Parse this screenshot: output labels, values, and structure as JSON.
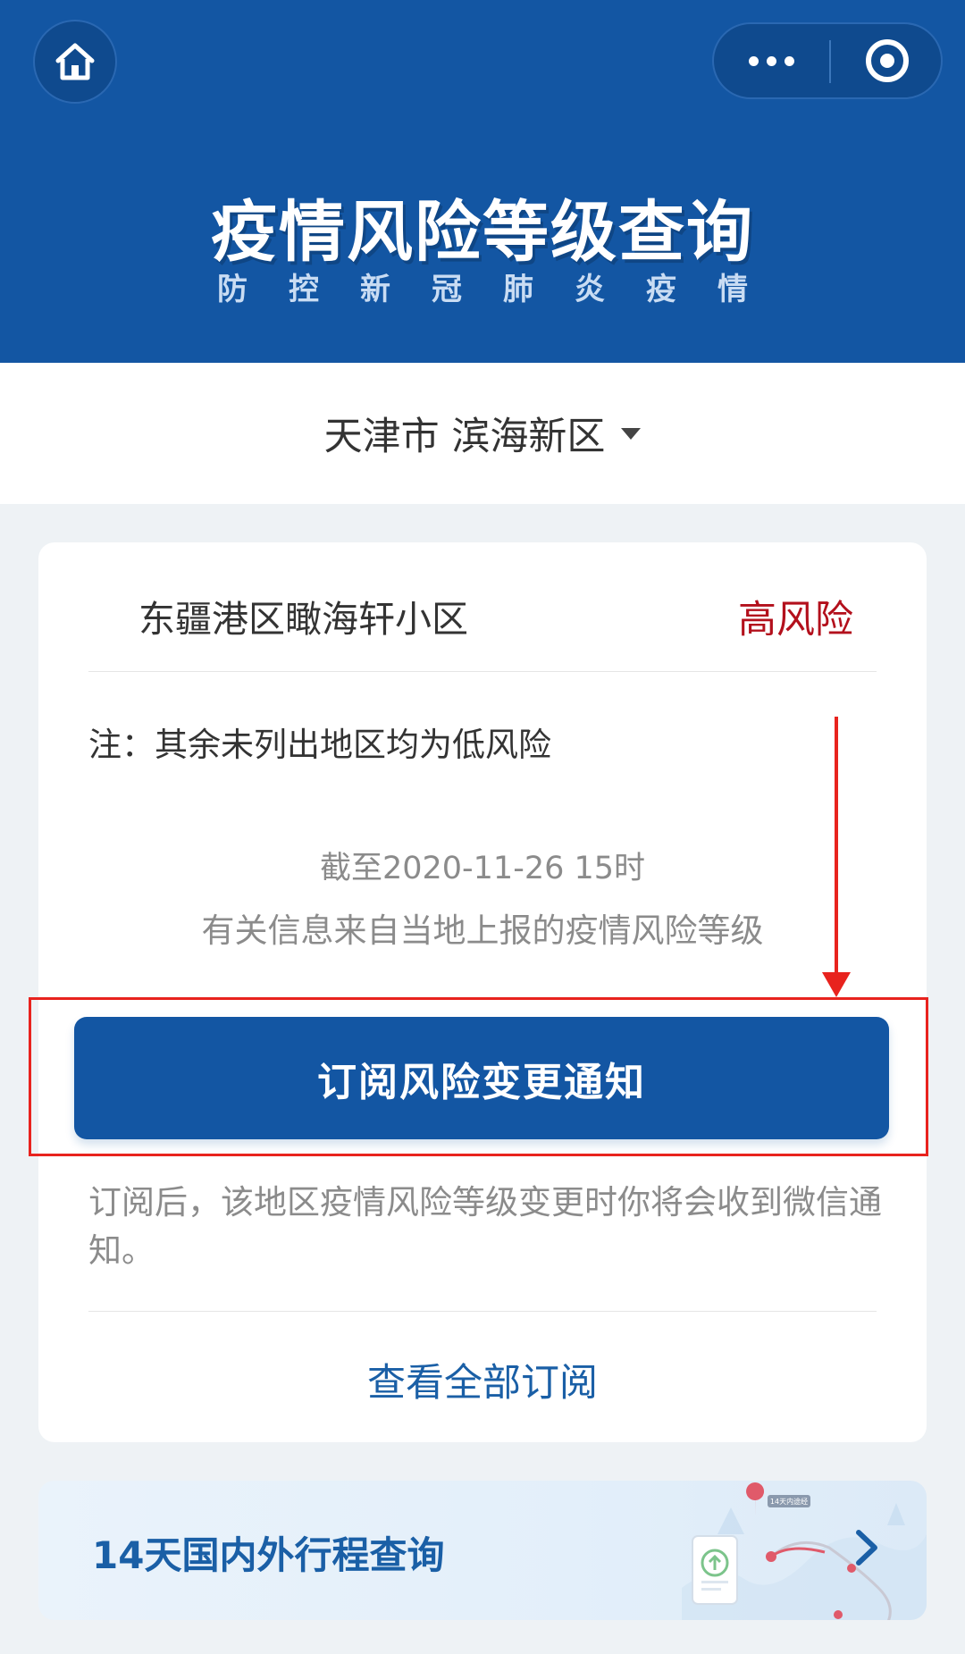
{
  "header": {
    "title": "疫情风险等级查询",
    "subtitle": "防控新冠肺炎疫情"
  },
  "region": {
    "label": "天津市 滨海新区"
  },
  "risk_card": {
    "place": "东疆港区瞰海轩小区",
    "level": "高风险",
    "level_color": "#b3101c",
    "note": "注：其余未列出地区均为低风险",
    "as_of": "截至2020-11-26 15时",
    "source": "有关信息来自当地上报的疫情风险等级",
    "subscribe_button": "订阅风险变更通知",
    "subscribe_hint": "订阅后，该地区疫情风险等级变更时你将会收到微信通知。",
    "view_all": "查看全部订阅"
  },
  "trip": {
    "label": "14天国内外行程查询",
    "art_badge": "14天内途经"
  },
  "colors": {
    "primary": "#1356a3",
    "highlight": "#e8231e"
  },
  "icons": [
    "home-icon",
    "more-icon",
    "close-mini-program-icon",
    "chevron-right-icon"
  ]
}
